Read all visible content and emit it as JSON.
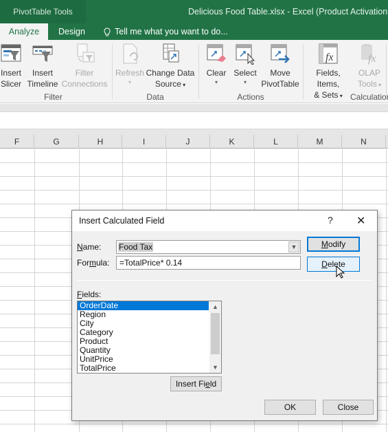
{
  "titlebar": {
    "context_tab": "PivotTable Tools",
    "window_title": "Delicious Food Table.xlsx - Excel (Product Activation Fa"
  },
  "tabs": [
    {
      "label": "Analyze",
      "active": true
    },
    {
      "label": "Design",
      "active": false
    }
  ],
  "tell_me": "Tell me what you want to do...",
  "ribbon": {
    "groups": [
      {
        "label": "Filter",
        "buttons": [
          {
            "line1": "Insert",
            "line2": "Slicer",
            "enabled": true
          },
          {
            "line1": "Insert",
            "line2": "Timeline",
            "enabled": true
          },
          {
            "line1": "Filter",
            "line2": "Connections",
            "enabled": false
          }
        ]
      },
      {
        "label": "Data",
        "buttons": [
          {
            "line1": "Refresh",
            "line2": "",
            "enabled": false,
            "dropdown": true
          },
          {
            "line1": "Change Data",
            "line2": "Source",
            "enabled": true,
            "dropdown": true
          }
        ]
      },
      {
        "label": "Actions",
        "buttons": [
          {
            "line1": "Clear",
            "line2": "",
            "enabled": true,
            "dropdown": true
          },
          {
            "line1": "Select",
            "line2": "",
            "enabled": true,
            "dropdown": true
          },
          {
            "line1": "Move",
            "line2": "PivotTable",
            "enabled": true
          }
        ]
      },
      {
        "label": "Calculation",
        "buttons": [
          {
            "line1": "Fields, Items,",
            "line2": "& Sets",
            "enabled": true,
            "dropdown": true
          },
          {
            "line1": "OLAP",
            "line2": "Tools",
            "enabled": false,
            "dropdown": true
          }
        ]
      }
    ]
  },
  "sheet": {
    "columns": [
      "F",
      "G",
      "H",
      "I",
      "J",
      "K",
      "L",
      "M",
      "N"
    ]
  },
  "dialog": {
    "title": "Insert Calculated Field",
    "help": "?",
    "close": "✕",
    "name_label_u": "N",
    "name_label_rest": "ame:",
    "name_value": "Food Tax",
    "formula_label_a": "For",
    "formula_label_u": "m",
    "formula_label_b": "ula:",
    "formula_value": "=TotalPrice* 0.14",
    "modify_u": "M",
    "modify_rest": "odify",
    "delete_u": "D",
    "delete_rest": "elete",
    "fields_label_u": "F",
    "fields_label_rest": "ields:",
    "fields": [
      "OrderDate",
      "Region",
      "City",
      "Category",
      "Product",
      "Quantity",
      "UnitPrice",
      "TotalPrice"
    ],
    "selected_field": "OrderDate",
    "insert_field_a": "Insert Fi",
    "insert_field_u": "e",
    "insert_field_b": "ld",
    "ok": "OK",
    "close_button": "Close"
  }
}
